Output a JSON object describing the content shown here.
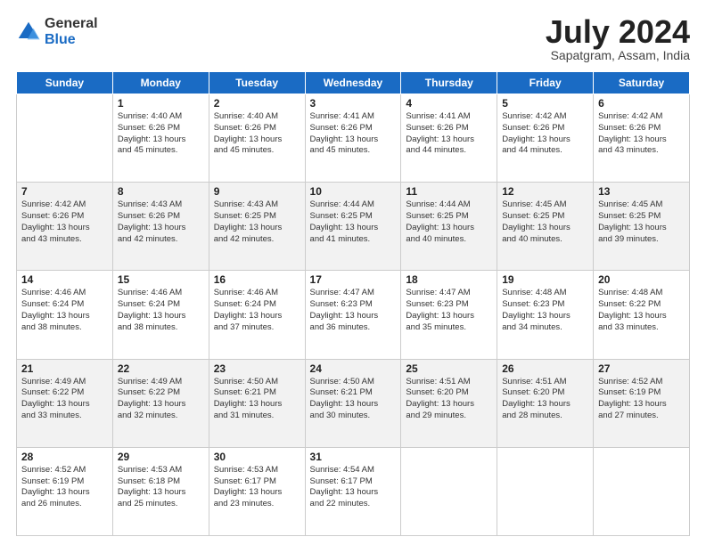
{
  "logo": {
    "general": "General",
    "blue": "Blue"
  },
  "title": "July 2024",
  "location": "Sapatgram, Assam, India",
  "days_of_week": [
    "Sunday",
    "Monday",
    "Tuesday",
    "Wednesday",
    "Thursday",
    "Friday",
    "Saturday"
  ],
  "weeks": [
    [
      {
        "num": "",
        "info": ""
      },
      {
        "num": "1",
        "info": "Sunrise: 4:40 AM\nSunset: 6:26 PM\nDaylight: 13 hours\nand 45 minutes."
      },
      {
        "num": "2",
        "info": "Sunrise: 4:40 AM\nSunset: 6:26 PM\nDaylight: 13 hours\nand 45 minutes."
      },
      {
        "num": "3",
        "info": "Sunrise: 4:41 AM\nSunset: 6:26 PM\nDaylight: 13 hours\nand 45 minutes."
      },
      {
        "num": "4",
        "info": "Sunrise: 4:41 AM\nSunset: 6:26 PM\nDaylight: 13 hours\nand 44 minutes."
      },
      {
        "num": "5",
        "info": "Sunrise: 4:42 AM\nSunset: 6:26 PM\nDaylight: 13 hours\nand 44 minutes."
      },
      {
        "num": "6",
        "info": "Sunrise: 4:42 AM\nSunset: 6:26 PM\nDaylight: 13 hours\nand 43 minutes."
      }
    ],
    [
      {
        "num": "7",
        "info": "Sunrise: 4:42 AM\nSunset: 6:26 PM\nDaylight: 13 hours\nand 43 minutes."
      },
      {
        "num": "8",
        "info": "Sunrise: 4:43 AM\nSunset: 6:26 PM\nDaylight: 13 hours\nand 42 minutes."
      },
      {
        "num": "9",
        "info": "Sunrise: 4:43 AM\nSunset: 6:25 PM\nDaylight: 13 hours\nand 42 minutes."
      },
      {
        "num": "10",
        "info": "Sunrise: 4:44 AM\nSunset: 6:25 PM\nDaylight: 13 hours\nand 41 minutes."
      },
      {
        "num": "11",
        "info": "Sunrise: 4:44 AM\nSunset: 6:25 PM\nDaylight: 13 hours\nand 40 minutes."
      },
      {
        "num": "12",
        "info": "Sunrise: 4:45 AM\nSunset: 6:25 PM\nDaylight: 13 hours\nand 40 minutes."
      },
      {
        "num": "13",
        "info": "Sunrise: 4:45 AM\nSunset: 6:25 PM\nDaylight: 13 hours\nand 39 minutes."
      }
    ],
    [
      {
        "num": "14",
        "info": "Sunrise: 4:46 AM\nSunset: 6:24 PM\nDaylight: 13 hours\nand 38 minutes."
      },
      {
        "num": "15",
        "info": "Sunrise: 4:46 AM\nSunset: 6:24 PM\nDaylight: 13 hours\nand 38 minutes."
      },
      {
        "num": "16",
        "info": "Sunrise: 4:46 AM\nSunset: 6:24 PM\nDaylight: 13 hours\nand 37 minutes."
      },
      {
        "num": "17",
        "info": "Sunrise: 4:47 AM\nSunset: 6:23 PM\nDaylight: 13 hours\nand 36 minutes."
      },
      {
        "num": "18",
        "info": "Sunrise: 4:47 AM\nSunset: 6:23 PM\nDaylight: 13 hours\nand 35 minutes."
      },
      {
        "num": "19",
        "info": "Sunrise: 4:48 AM\nSunset: 6:23 PM\nDaylight: 13 hours\nand 34 minutes."
      },
      {
        "num": "20",
        "info": "Sunrise: 4:48 AM\nSunset: 6:22 PM\nDaylight: 13 hours\nand 33 minutes."
      }
    ],
    [
      {
        "num": "21",
        "info": "Sunrise: 4:49 AM\nSunset: 6:22 PM\nDaylight: 13 hours\nand 33 minutes."
      },
      {
        "num": "22",
        "info": "Sunrise: 4:49 AM\nSunset: 6:22 PM\nDaylight: 13 hours\nand 32 minutes."
      },
      {
        "num": "23",
        "info": "Sunrise: 4:50 AM\nSunset: 6:21 PM\nDaylight: 13 hours\nand 31 minutes."
      },
      {
        "num": "24",
        "info": "Sunrise: 4:50 AM\nSunset: 6:21 PM\nDaylight: 13 hours\nand 30 minutes."
      },
      {
        "num": "25",
        "info": "Sunrise: 4:51 AM\nSunset: 6:20 PM\nDaylight: 13 hours\nand 29 minutes."
      },
      {
        "num": "26",
        "info": "Sunrise: 4:51 AM\nSunset: 6:20 PM\nDaylight: 13 hours\nand 28 minutes."
      },
      {
        "num": "27",
        "info": "Sunrise: 4:52 AM\nSunset: 6:19 PM\nDaylight: 13 hours\nand 27 minutes."
      }
    ],
    [
      {
        "num": "28",
        "info": "Sunrise: 4:52 AM\nSunset: 6:19 PM\nDaylight: 13 hours\nand 26 minutes."
      },
      {
        "num": "29",
        "info": "Sunrise: 4:53 AM\nSunset: 6:18 PM\nDaylight: 13 hours\nand 25 minutes."
      },
      {
        "num": "30",
        "info": "Sunrise: 4:53 AM\nSunset: 6:17 PM\nDaylight: 13 hours\nand 23 minutes."
      },
      {
        "num": "31",
        "info": "Sunrise: 4:54 AM\nSunset: 6:17 PM\nDaylight: 13 hours\nand 22 minutes."
      },
      {
        "num": "",
        "info": ""
      },
      {
        "num": "",
        "info": ""
      },
      {
        "num": "",
        "info": ""
      }
    ]
  ]
}
